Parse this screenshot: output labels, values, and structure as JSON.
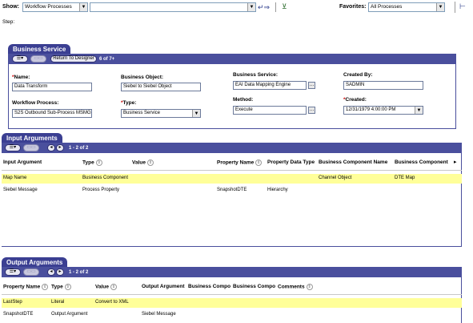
{
  "toolbar": {
    "show_label": "Show:",
    "show_value": "Workflow Processes",
    "search_value": "",
    "favorites_label": "Favorites:",
    "favorites_value": "All Processes",
    "step_label": "Step:"
  },
  "business_service": {
    "tab": "Business Service",
    "return_button": "Return To Designer",
    "count": "6 of 7+",
    "fields": {
      "name_label": "Name:",
      "name_value": "Data Transform",
      "business_object_label": "Business Object:",
      "business_object_value": "Siebel to Siebel Object",
      "business_service_label": "Business Service:",
      "business_service_value": "EAI Data Mapping Engine",
      "created_by_label": "Created By:",
      "created_by_value": "SADMIN",
      "workflow_process_label": "Workflow Process:",
      "workflow_process_value": "S2S Outbound Sub-Process MSMG",
      "type_label": "Type:",
      "type_value": "Business Service",
      "method_label": "Method:",
      "method_value": "Execute",
      "created_label": "Created:",
      "created_value": "12/31/1979 4:00:00 PM"
    }
  },
  "input_arguments": {
    "tab": "Input Arguments",
    "count": "1 - 2 of 2",
    "columns": [
      "Input Argument",
      "Type",
      "Value",
      "Property Name",
      "Property Data Type",
      "Business Component Name",
      "Business Component"
    ],
    "rows": [
      [
        "Map Name",
        "Business Component",
        "",
        "",
        "",
        "Channel Object",
        "DTE Map"
      ],
      [
        "Siebel Message",
        "Process Property",
        "",
        "SnapshotDTE",
        "Hierarchy",
        "",
        ""
      ]
    ]
  },
  "output_arguments": {
    "tab": "Output Arguments",
    "count": "1 - 2 of 2",
    "columns": [
      "Property Name",
      "Type",
      "Value",
      "Output Argument",
      "Business Compo",
      "Business Compo",
      "Comments"
    ],
    "rows": [
      [
        "LastStep",
        "Literal",
        "Convert to XML",
        "",
        "",
        "",
        ""
      ],
      [
        "SnapshotDTE",
        "Output Argument",
        "",
        "Siebel Message",
        "",
        "",
        ""
      ]
    ]
  }
}
